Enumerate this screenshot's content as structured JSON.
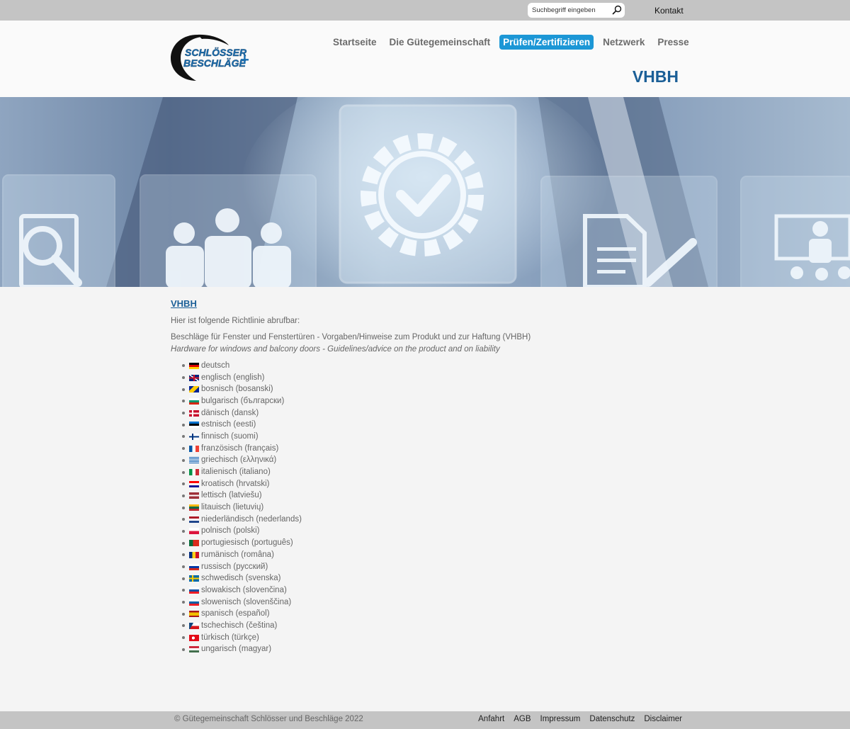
{
  "topbar": {
    "search_placeholder": "Suchbegriff eingeben",
    "kontakt_label": "Kontakt"
  },
  "header": {
    "logo_line1": "SCHLÖSSER",
    "logo_line2": "BESCHLÄGE",
    "logo_plus": "+",
    "nav": [
      {
        "label": "Startseite",
        "active": false
      },
      {
        "label": "Die Gütegemeinschaft",
        "active": false
      },
      {
        "label": "Prüfen/Zertifizieren",
        "active": true
      },
      {
        "label": "Netzwerk",
        "active": false
      },
      {
        "label": "Presse",
        "active": false
      }
    ],
    "page_title": "VHBH"
  },
  "content": {
    "heading": "VHBH",
    "intro": "Hier ist folgende Richtlinie abrufbar:",
    "title_de": "Beschläge für Fenster und Fenstertüren - Vorgaben/Hinweise zum Produkt und zur Haftung (VHBH)",
    "title_en": "Hardware for windows and balcony doors - Guidelines/advice on the product and on liability",
    "languages": [
      {
        "label": "deutsch",
        "flag": "de"
      },
      {
        "label": "englisch (english)",
        "flag": "gb"
      },
      {
        "label": "bosnisch (bosanski)",
        "flag": "ba"
      },
      {
        "label": "bulgarisch (български)",
        "flag": "bg"
      },
      {
        "label": "dänisch (dansk)",
        "flag": "dk"
      },
      {
        "label": "estnisch (eesti)",
        "flag": "ee"
      },
      {
        "label": "finnisch (suomi)",
        "flag": "fi"
      },
      {
        "label": "französisch (français)",
        "flag": "fr"
      },
      {
        "label": "griechisch (ελληνικά)",
        "flag": "gr"
      },
      {
        "label": "italienisch (italiano)",
        "flag": "it"
      },
      {
        "label": "kroatisch (hrvatski)",
        "flag": "hr"
      },
      {
        "label": "lettisch (latviešu)",
        "flag": "lv"
      },
      {
        "label": "litauisch (lietuvių)",
        "flag": "lt"
      },
      {
        "label": "niederländisch (nederlands)",
        "flag": "nl"
      },
      {
        "label": "polnisch (polski)",
        "flag": "pl"
      },
      {
        "label": "portugiesisch (português)",
        "flag": "pt"
      },
      {
        "label": "rumänisch (româna)",
        "flag": "ro"
      },
      {
        "label": "russisch (русский)",
        "flag": "ru"
      },
      {
        "label": "schwedisch (svenska)",
        "flag": "se"
      },
      {
        "label": "slowakisch (slovenčina)",
        "flag": "sk"
      },
      {
        "label": "slowenisch (slovenščina)",
        "flag": "si"
      },
      {
        "label": "spanisch (español)",
        "flag": "es"
      },
      {
        "label": "tschechisch (čeština)",
        "flag": "cz"
      },
      {
        "label": "türkisch (türkçe)",
        "flag": "tr"
      },
      {
        "label": "ungarisch (magyar)",
        "flag": "hu"
      }
    ]
  },
  "footer": {
    "copyright": "© Gütegemeinschaft Schlösser und Beschläge 2022",
    "links": [
      "Anfahrt",
      "AGB",
      "Impressum",
      "Datenschutz",
      "Disclaimer"
    ]
  },
  "colors": {
    "accent": "#1c97d6",
    "title_blue": "#1b5f97",
    "bar_grey": "#c4c4c4"
  }
}
